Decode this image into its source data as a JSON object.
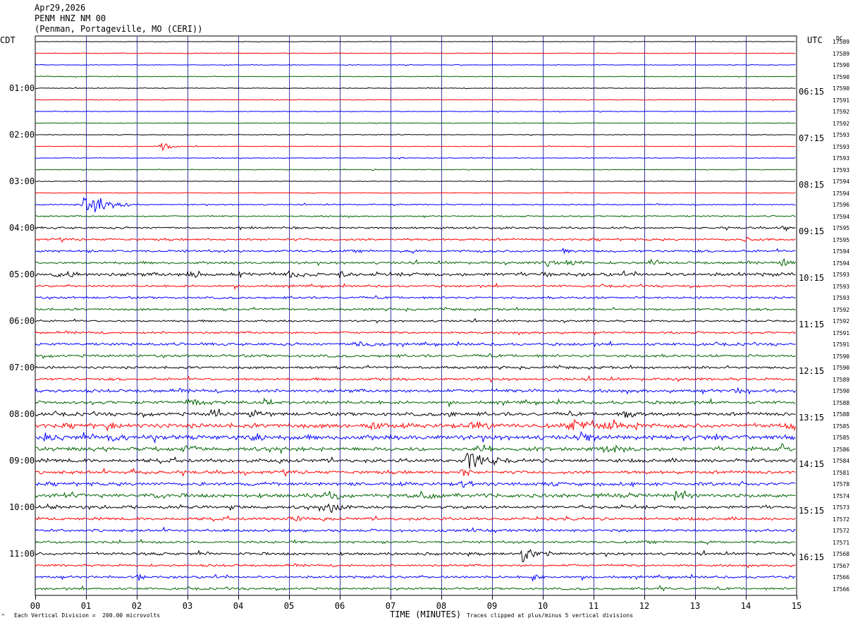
{
  "header": {
    "date": "Apr29,2026",
    "station": "PENM HNZ NM 00",
    "location": "(Penman, Portageville, MO (CERI))"
  },
  "left_timezone": "CDT",
  "right_timezone": "UTC",
  "dc_label": "DC",
  "footer": {
    "division_note": "Each Vertical Division =  200.00 microvolts",
    "xlabel": "TIME (MINUTES)",
    "clip_note": "Traces clipped at plus/minus 5 vertical divisions",
    "corner_mark": "^"
  },
  "colors": {
    "trace_cycle": [
      "#000000",
      "#ff0000",
      "#0000ff",
      "#006400"
    ],
    "grid": "#3a3aa8",
    "frame": "#000000"
  },
  "chart_data": {
    "type": "line",
    "title": "PENM HNZ NM 00",
    "xlabel": "TIME (MINUTES)",
    "ylabel": "",
    "xlim": [
      0,
      15
    ],
    "x_ticks": [
      "00",
      "01",
      "02",
      "03",
      "04",
      "05",
      "06",
      "07",
      "08",
      "09",
      "10",
      "11",
      "12",
      "13",
      "14",
      "15"
    ],
    "row_count": 48,
    "rows_per_hour": 4,
    "grid": true,
    "left_time_labels": [
      {
        "row": 4,
        "text": "01:00"
      },
      {
        "row": 8,
        "text": "02:00"
      },
      {
        "row": 12,
        "text": "03:00"
      },
      {
        "row": 16,
        "text": "04:00"
      },
      {
        "row": 20,
        "text": "05:00"
      },
      {
        "row": 24,
        "text": "06:00"
      },
      {
        "row": 28,
        "text": "07:00"
      },
      {
        "row": 32,
        "text": "08:00"
      },
      {
        "row": 36,
        "text": "09:00"
      },
      {
        "row": 40,
        "text": "10:00"
      },
      {
        "row": 44,
        "text": "11:00"
      }
    ],
    "right_time_labels": [
      {
        "row": 4,
        "text": "06:15"
      },
      {
        "row": 8,
        "text": "07:15"
      },
      {
        "row": 12,
        "text": "08:15"
      },
      {
        "row": 16,
        "text": "09:15"
      },
      {
        "row": 20,
        "text": "10:15"
      },
      {
        "row": 24,
        "text": "11:15"
      },
      {
        "row": 28,
        "text": "12:15"
      },
      {
        "row": 32,
        "text": "13:15"
      },
      {
        "row": 36,
        "text": "14:15"
      },
      {
        "row": 40,
        "text": "15:15"
      },
      {
        "row": 44,
        "text": "16:15"
      }
    ],
    "dc_values": [
      "17589",
      "17589",
      "17590",
      "17590",
      "17590",
      "17591",
      "17592",
      "17592",
      "17593",
      "17593",
      "17593",
      "17593",
      "17594",
      "17594",
      "17596",
      "17594",
      "17595",
      "17595",
      "17594",
      "17594",
      "17593",
      "17593",
      "17593",
      "17592",
      "17592",
      "17591",
      "17591",
      "17590",
      "17590",
      "17589",
      "17590",
      "17588",
      "17588",
      "17585",
      "17585",
      "17586",
      "17584",
      "17581",
      "17578",
      "17574",
      "17573",
      "17572",
      "17572",
      "17571",
      "17568",
      "17567",
      "17566",
      "17566"
    ],
    "noise_level": [
      0.2,
      0.3,
      0.3,
      0.3,
      0.3,
      0.3,
      0.3,
      0.3,
      0.3,
      0.3,
      0.3,
      0.3,
      0.3,
      0.3,
      0.5,
      0.6,
      0.8,
      0.9,
      1.0,
      1.0,
      1.4,
      0.9,
      0.9,
      0.9,
      0.8,
      0.9,
      1.1,
      1.1,
      1.0,
      1.1,
      1.3,
      1.3,
      1.4,
      1.8,
      1.9,
      1.6,
      1.5,
      1.3,
      1.4,
      1.6,
      1.3,
      1.2,
      1.1,
      1.0,
      1.1,
      0.9,
      1.0,
      0.9
    ],
    "events": [
      {
        "row": 9,
        "minute": 2.45,
        "amplitude": 9,
        "duration": 0.4
      },
      {
        "row": 10,
        "minute": 7.2,
        "amplitude": 3,
        "duration": 0.08
      },
      {
        "row": 11,
        "minute": 6.65,
        "amplitude": 3,
        "duration": 0.08
      },
      {
        "row": 14,
        "minute": 0.95,
        "amplitude": 20,
        "duration": 0.9
      },
      {
        "row": 16,
        "minute": 14.7,
        "amplitude": 3,
        "duration": 0.3
      },
      {
        "row": 17,
        "minute": 14.0,
        "amplitude": 4,
        "duration": 0.4
      },
      {
        "row": 18,
        "minute": 10.4,
        "amplitude": 5,
        "duration": 0.2
      },
      {
        "row": 19,
        "minute": 10.0,
        "amplitude": 8,
        "duration": 0.4
      },
      {
        "row": 19,
        "minute": 10.5,
        "amplitude": 6,
        "duration": 0.4
      },
      {
        "row": 19,
        "minute": 12.1,
        "amplitude": 7,
        "duration": 0.3
      },
      {
        "row": 19,
        "minute": 14.7,
        "amplitude": 8,
        "duration": 0.3
      },
      {
        "row": 20,
        "minute": 0.4,
        "amplitude": 6,
        "duration": 0.5
      },
      {
        "row": 20,
        "minute": 3.0,
        "amplitude": 7,
        "duration": 0.5
      },
      {
        "row": 20,
        "minute": 4.0,
        "amplitude": 5,
        "duration": 0.3
      },
      {
        "row": 20,
        "minute": 5.0,
        "amplitude": 6,
        "duration": 0.6
      },
      {
        "row": 20,
        "minute": 6.0,
        "amplitude": 5,
        "duration": 0.3
      },
      {
        "row": 20,
        "minute": 10.0,
        "amplitude": 4,
        "duration": 0.2
      },
      {
        "row": 26,
        "minute": 6.3,
        "amplitude": 4,
        "duration": 0.8
      },
      {
        "row": 30,
        "minute": 9.7,
        "amplitude": 4,
        "duration": 0.3
      },
      {
        "row": 30,
        "minute": 13.8,
        "amplitude": 5,
        "duration": 0.3
      },
      {
        "row": 31,
        "minute": 3.0,
        "amplitude": 5,
        "duration": 0.5
      },
      {
        "row": 31,
        "minute": 4.5,
        "amplitude": 5,
        "duration": 0.4
      },
      {
        "row": 32,
        "minute": 3.5,
        "amplitude": 7,
        "duration": 0.3
      },
      {
        "row": 32,
        "minute": 4.2,
        "amplitude": 6,
        "duration": 0.5
      },
      {
        "row": 32,
        "minute": 8.1,
        "amplitude": 6,
        "duration": 0.3
      },
      {
        "row": 32,
        "minute": 11.6,
        "amplitude": 8,
        "duration": 0.4
      },
      {
        "row": 33,
        "minute": 1.4,
        "amplitude": 6,
        "duration": 0.4
      },
      {
        "row": 33,
        "minute": 6.6,
        "amplitude": 6,
        "duration": 0.4
      },
      {
        "row": 33,
        "minute": 8.6,
        "amplitude": 8,
        "duration": 0.6
      },
      {
        "row": 33,
        "minute": 10.5,
        "amplitude": 10,
        "duration": 1.5
      },
      {
        "row": 33,
        "minute": 14.8,
        "amplitude": 8,
        "duration": 0.3
      },
      {
        "row": 34,
        "minute": 0.2,
        "amplitude": 9,
        "duration": 0.4
      },
      {
        "row": 34,
        "minute": 1.4,
        "amplitude": 7,
        "duration": 0.6
      },
      {
        "row": 34,
        "minute": 4.3,
        "amplitude": 7,
        "duration": 0.4
      },
      {
        "row": 34,
        "minute": 10.8,
        "amplitude": 5,
        "duration": 0.4
      },
      {
        "row": 35,
        "minute": 2.9,
        "amplitude": 10,
        "duration": 0.3
      },
      {
        "row": 35,
        "minute": 8.8,
        "amplitude": 7,
        "duration": 0.5
      },
      {
        "row": 35,
        "minute": 11.3,
        "amplitude": 7,
        "duration": 0.6
      },
      {
        "row": 35,
        "minute": 14.7,
        "amplitude": 8,
        "duration": 0.3
      },
      {
        "row": 36,
        "minute": 8.5,
        "amplitude": 14,
        "duration": 0.9
      },
      {
        "row": 37,
        "minute": 1.9,
        "amplitude": 6,
        "duration": 0.2
      },
      {
        "row": 37,
        "minute": 8.4,
        "amplitude": 8,
        "duration": 0.3
      },
      {
        "row": 38,
        "minute": 8.4,
        "amplitude": 8,
        "duration": 0.3
      },
      {
        "row": 39,
        "minute": 2.3,
        "amplitude": 9,
        "duration": 0.3
      },
      {
        "row": 39,
        "minute": 5.7,
        "amplitude": 7,
        "duration": 0.6
      },
      {
        "row": 39,
        "minute": 7.6,
        "amplitude": 8,
        "duration": 0.5
      },
      {
        "row": 39,
        "minute": 12.6,
        "amplitude": 9,
        "duration": 0.4
      },
      {
        "row": 40,
        "minute": 5.7,
        "amplitude": 11,
        "duration": 0.6
      },
      {
        "row": 41,
        "minute": 5.0,
        "amplitude": 5,
        "duration": 0.5
      },
      {
        "row": 44,
        "minute": 9.6,
        "amplitude": 12,
        "duration": 0.6
      },
      {
        "row": 46,
        "minute": 2.0,
        "amplitude": 7,
        "duration": 0.2
      },
      {
        "row": 46,
        "minute": 9.8,
        "amplitude": 5,
        "duration": 0.3
      },
      {
        "row": 47,
        "minute": 12.3,
        "amplitude": 5,
        "duration": 0.3
      }
    ]
  }
}
